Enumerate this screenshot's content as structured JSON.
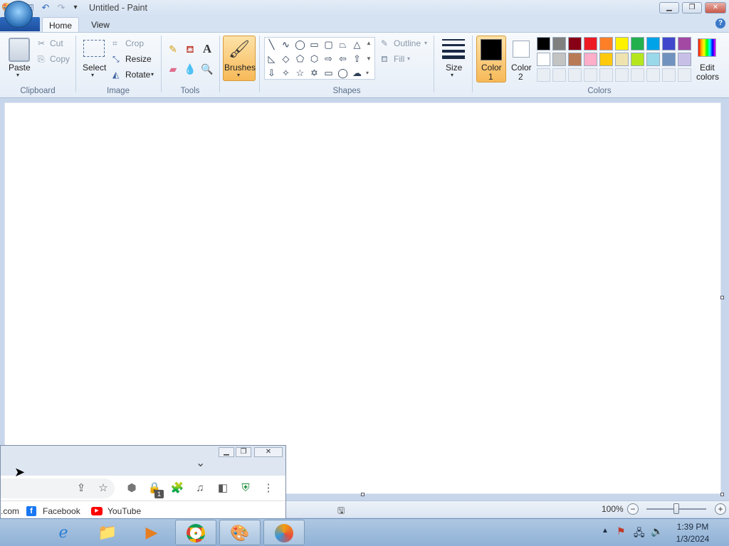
{
  "window": {
    "title": "Untitled - Paint",
    "minimize": "▁",
    "restore": "❐",
    "close": "✕"
  },
  "qat": {
    "save_icon": "save-icon",
    "undo_icon": "undo-icon",
    "redo_icon": "redo-icon",
    "customize": "▾"
  },
  "tabs": {
    "home": "Home",
    "view": "View",
    "help": "?"
  },
  "clipboard": {
    "paste": "Paste",
    "cut": "Cut",
    "copy": "Copy",
    "group": "Clipboard"
  },
  "image": {
    "select": "Select",
    "crop": "Crop",
    "resize": "Resize",
    "rotate": "Rotate",
    "group": "Image"
  },
  "tools": {
    "group": "Tools",
    "text_tool": "A"
  },
  "brushes": {
    "label": "Brushes"
  },
  "shapes": {
    "outline": "Outline",
    "fill": "Fill",
    "group": "Shapes"
  },
  "size": {
    "label": "Size"
  },
  "colors": {
    "color1": "Color",
    "color1_num": "1",
    "color2": "Color",
    "color2_num": "2",
    "edit": "Edit",
    "edit2": "colors",
    "group": "Colors",
    "color1_value": "#000000",
    "color2_value": "#ffffff",
    "palette_row1": [
      "#000000",
      "#7f7f7f",
      "#880015",
      "#ed1c24",
      "#ff7f27",
      "#fff200",
      "#22b14c",
      "#00a2e8",
      "#3f48cc",
      "#a349a4"
    ],
    "palette_row2": [
      "#ffffff",
      "#c3c3c3",
      "#b97a57",
      "#ffaec9",
      "#ffc90e",
      "#efe4b0",
      "#b5e61d",
      "#99d9ea",
      "#7092be",
      "#c8bfe7"
    ]
  },
  "status": {
    "zoom": "100%",
    "zoom_out": "−",
    "zoom_in": "+"
  },
  "chrome": {
    "bookmark_prefix": ".com",
    "bookmark1": "Facebook",
    "bookmark2": "YouTube",
    "badge": "1",
    "minimize": "▁",
    "restore": "❐",
    "close": "✕",
    "tabs_dropdown": "⌄"
  },
  "taskbar": {
    "time": "1:39 PM",
    "date": "1/3/2024"
  }
}
